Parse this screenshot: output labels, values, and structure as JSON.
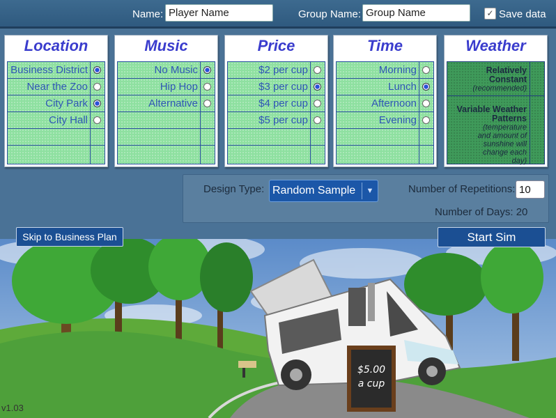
{
  "top": {
    "name_label": "Name:",
    "name_placeholder": "Player Name",
    "group_label": "Group Name:",
    "group_placeholder": "Group Name",
    "save_label": "Save data",
    "save_checked": true
  },
  "panels": {
    "location": {
      "title": "Location",
      "options": [
        {
          "label": "Business District",
          "selected": true
        },
        {
          "label": "Near the Zoo",
          "selected": false
        },
        {
          "label": "City Park",
          "selected": true
        },
        {
          "label": "City Hall",
          "selected": false
        }
      ]
    },
    "music": {
      "title": "Music",
      "options": [
        {
          "label": "No Music",
          "selected": true
        },
        {
          "label": "Hip Hop",
          "selected": false
        },
        {
          "label": "Alternative",
          "selected": false
        }
      ]
    },
    "price": {
      "title": "Price",
      "options": [
        {
          "label": "$2 per cup",
          "selected": false
        },
        {
          "label": "$3 per cup",
          "selected": true
        },
        {
          "label": "$4 per cup",
          "selected": false
        },
        {
          "label": "$5 per cup",
          "selected": false
        }
      ]
    },
    "time": {
      "title": "Time",
      "options": [
        {
          "label": "Morning",
          "selected": false
        },
        {
          "label": "Lunch",
          "selected": true
        },
        {
          "label": "Afternoon",
          "selected": false
        },
        {
          "label": "Evening",
          "selected": false
        }
      ]
    },
    "weather": {
      "title": "Weather",
      "opt1_title": "Relatively Constant",
      "opt1_note": "(recommended)",
      "opt2_title": "Variable Weather Patterns",
      "opt2_note": "(temperature and amount of sunshine will change each day)"
    }
  },
  "design": {
    "design_type_label": "Design Type:",
    "design_type_value": "Random Sample",
    "repetitions_label": "Number of Repetitions:",
    "repetitions_value": "10",
    "days_label": "Number of Days: 20"
  },
  "buttons": {
    "skip": "Skip to Business Plan",
    "start": "Start Sim"
  },
  "scene": {
    "sign_line1": "$5.00",
    "sign_line2": "a cup"
  },
  "version": "v1.03",
  "colors": {
    "title_blue": "#3a3ccd",
    "grid_green": "#8ee0a0",
    "weather_green": "#3f9a5a",
    "button_blue": "#1b4f93"
  }
}
